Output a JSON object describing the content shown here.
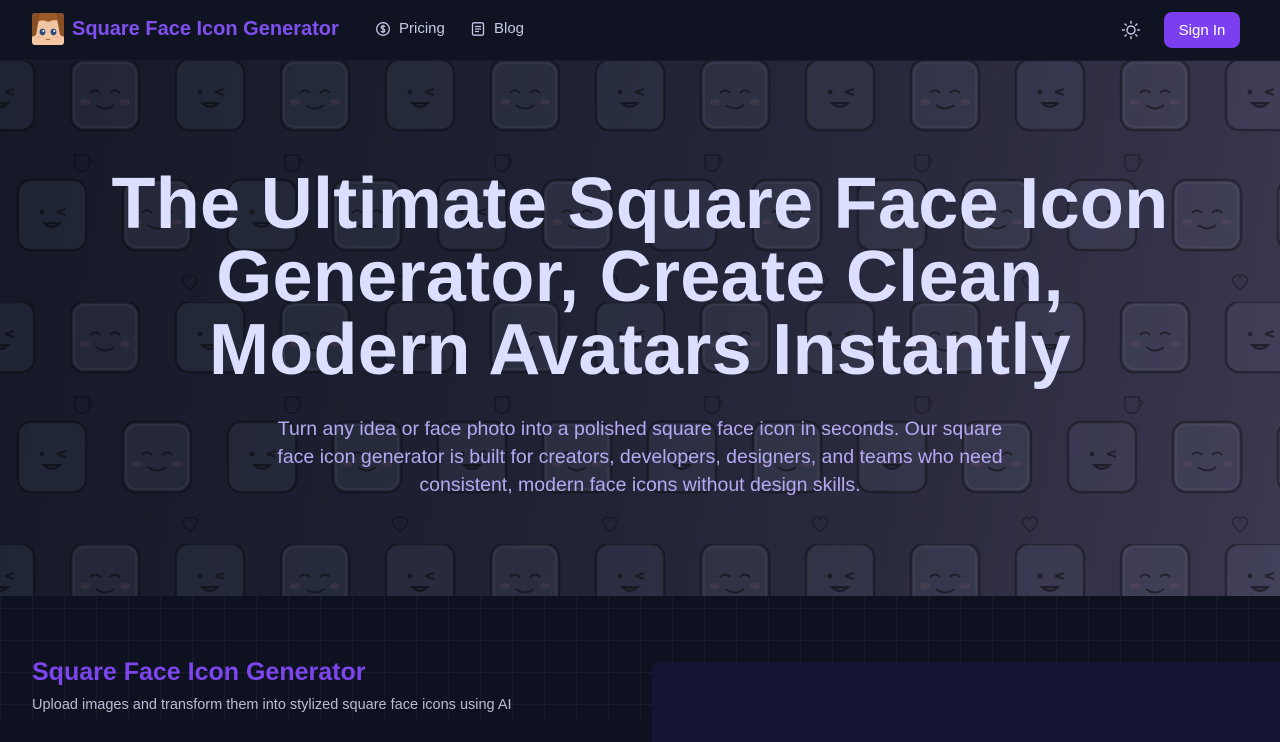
{
  "nav": {
    "brand": "Square Face Icon Generator",
    "logo_icon": "square-face-avatar",
    "items": [
      {
        "label": "Pricing",
        "icon": "dollar-circle-icon"
      },
      {
        "label": "Blog",
        "icon": "document-icon"
      }
    ],
    "theme_icon": "sun-icon",
    "signin_label": "Sign In"
  },
  "hero": {
    "title": "The Ultimate Square Face Icon Generator, Create Clean, Modern Avatars Instantly",
    "subtitle": "Turn any idea or face photo into a polished square face icon in seconds. Our square face icon generator is built for creators, developers, designers, and teams who need consistent, modern face icons without design skills."
  },
  "tool": {
    "title": "Square Face Icon Generator",
    "description": "Upload images and transform them into stylized square face icons using AI"
  },
  "colors": {
    "accent": "#7b3ff0",
    "brand_text": "#7f4ff0",
    "background": "#0e1220",
    "hero_title": "#dcdfff",
    "hero_subtitle": "#b4a9f2"
  }
}
